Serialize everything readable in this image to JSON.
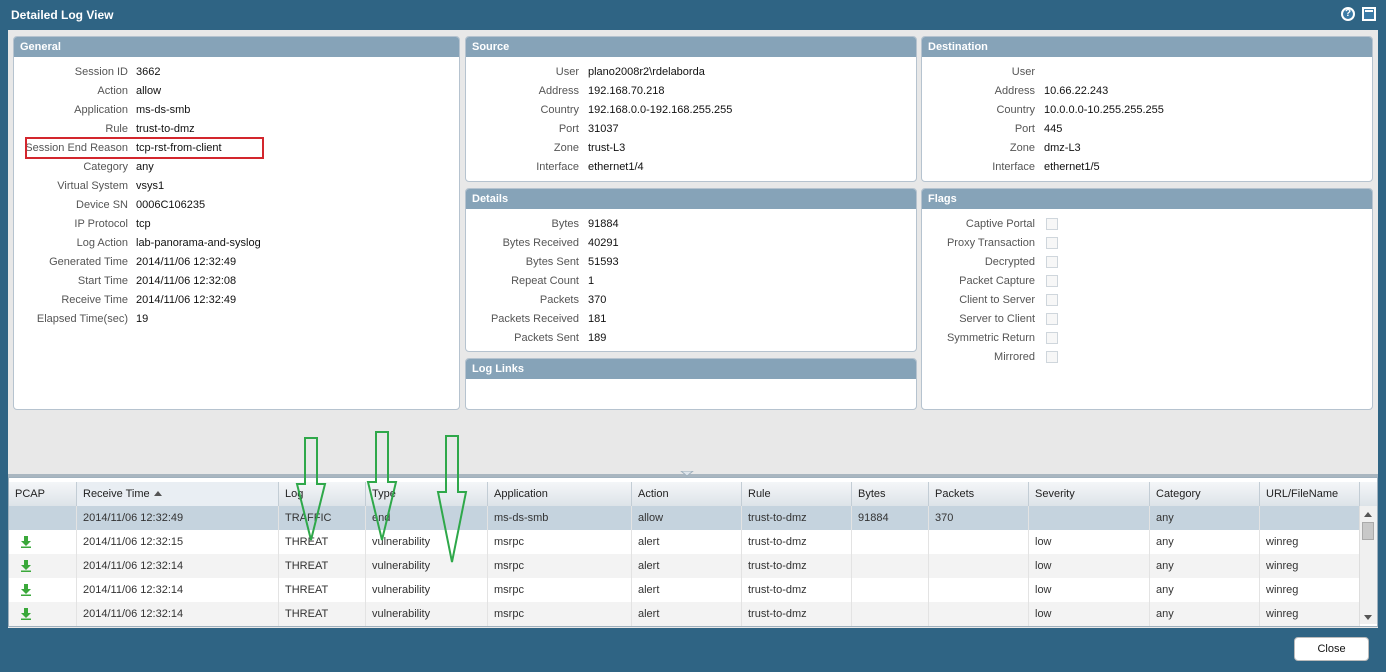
{
  "window": {
    "title": "Detailed Log View",
    "help_label": "?"
  },
  "general": {
    "header": "General",
    "fields": [
      {
        "label": "Session ID",
        "value": "3662"
      },
      {
        "label": "Action",
        "value": "allow"
      },
      {
        "label": "Application",
        "value": "ms-ds-smb"
      },
      {
        "label": "Rule",
        "value": "trust-to-dmz"
      },
      {
        "label": "Session End Reason",
        "value": "tcp-rst-from-client"
      },
      {
        "label": "Category",
        "value": "any"
      },
      {
        "label": "Virtual System",
        "value": "vsys1"
      },
      {
        "label": "Device SN",
        "value": "0006C106235"
      },
      {
        "label": "IP Protocol",
        "value": "tcp"
      },
      {
        "label": "Log Action",
        "value": "lab-panorama-and-syslog"
      },
      {
        "label": "Generated Time",
        "value": "2014/11/06 12:32:49"
      },
      {
        "label": "Start Time",
        "value": "2014/11/06 12:32:08"
      },
      {
        "label": "Receive Time",
        "value": "2014/11/06 12:32:49"
      },
      {
        "label": "Elapsed Time(sec)",
        "value": "19"
      }
    ]
  },
  "source": {
    "header": "Source",
    "fields": [
      {
        "label": "User",
        "value": "plano2008r2\\rdelaborda"
      },
      {
        "label": "Address",
        "value": "192.168.70.218"
      },
      {
        "label": "Country",
        "value": "192.168.0.0-192.168.255.255"
      },
      {
        "label": "Port",
        "value": "31037"
      },
      {
        "label": "Zone",
        "value": "trust-L3"
      },
      {
        "label": "Interface",
        "value": "ethernet1/4"
      }
    ]
  },
  "destination": {
    "header": "Destination",
    "fields": [
      {
        "label": "User",
        "value": ""
      },
      {
        "label": "Address",
        "value": "10.66.22.243"
      },
      {
        "label": "Country",
        "value": "10.0.0.0-10.255.255.255"
      },
      {
        "label": "Port",
        "value": "445"
      },
      {
        "label": "Zone",
        "value": "dmz-L3"
      },
      {
        "label": "Interface",
        "value": "ethernet1/5"
      }
    ]
  },
  "details": {
    "header": "Details",
    "fields": [
      {
        "label": "Bytes",
        "value": "91884"
      },
      {
        "label": "Bytes Received",
        "value": "40291"
      },
      {
        "label": "Bytes Sent",
        "value": "51593"
      },
      {
        "label": "Repeat Count",
        "value": "1"
      },
      {
        "label": "Packets",
        "value": "370"
      },
      {
        "label": "Packets Received",
        "value": "181"
      },
      {
        "label": "Packets Sent",
        "value": "189"
      }
    ]
  },
  "log_links": {
    "header": "Log Links"
  },
  "flags": {
    "header": "Flags",
    "items": [
      {
        "label": "Captive Portal",
        "checked": false
      },
      {
        "label": "Proxy Transaction",
        "checked": false
      },
      {
        "label": "Decrypted",
        "checked": false
      },
      {
        "label": "Packet Capture",
        "checked": false
      },
      {
        "label": "Client to Server",
        "checked": false
      },
      {
        "label": "Server to Client",
        "checked": false
      },
      {
        "label": "Symmetric Return",
        "checked": false
      },
      {
        "label": "Mirrored",
        "checked": false
      }
    ]
  },
  "grid": {
    "columns": [
      "PCAP",
      "Receive Time",
      "Log",
      "Type",
      "Application",
      "Action",
      "Rule",
      "Bytes",
      "Packets",
      "Severity",
      "Category",
      "URL/FileName"
    ],
    "sorted_column": "Receive Time",
    "rows": [
      {
        "pcap": false,
        "cells": [
          "",
          "2014/11/06 12:32:49",
          "TRAFFIC",
          "end",
          "ms-ds-smb",
          "allow",
          "trust-to-dmz",
          "91884",
          "370",
          "",
          "any",
          ""
        ]
      },
      {
        "pcap": true,
        "cells": [
          "",
          "2014/11/06 12:32:15",
          "THREAT",
          "vulnerability",
          "msrpc",
          "alert",
          "trust-to-dmz",
          "",
          "",
          "low",
          "any",
          "winreg"
        ]
      },
      {
        "pcap": true,
        "cells": [
          "",
          "2014/11/06 12:32:14",
          "THREAT",
          "vulnerability",
          "msrpc",
          "alert",
          "trust-to-dmz",
          "",
          "",
          "low",
          "any",
          "winreg"
        ]
      },
      {
        "pcap": true,
        "cells": [
          "",
          "2014/11/06 12:32:14",
          "THREAT",
          "vulnerability",
          "msrpc",
          "alert",
          "trust-to-dmz",
          "",
          "",
          "low",
          "any",
          "winreg"
        ]
      },
      {
        "pcap": true,
        "cells": [
          "",
          "2014/11/06 12:32:14",
          "THREAT",
          "vulnerability",
          "msrpc",
          "alert",
          "trust-to-dmz",
          "",
          "",
          "low",
          "any",
          "winreg"
        ]
      }
    ]
  },
  "footer": {
    "close_label": "Close"
  },
  "colors": {
    "window_frame": "#2f6484",
    "panel_header": "#86a3b8",
    "highlight_box": "#d3262d",
    "annotation_arrow": "#2fa84a",
    "pcap_icon": "#3aa83a"
  }
}
